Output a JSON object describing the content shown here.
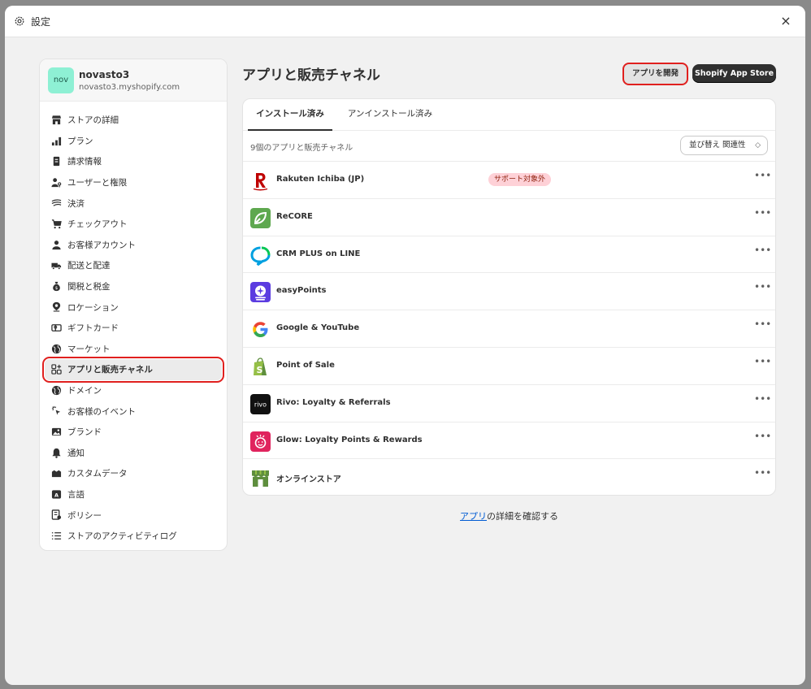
{
  "window": {
    "title": "設定",
    "close_label": "×"
  },
  "store": {
    "avatar": "nov",
    "name": "novasto3",
    "url": "novasto3.myshopify.com"
  },
  "sidebar": {
    "items": [
      {
        "label": "ストアの詳細",
        "icon": "store-icon"
      },
      {
        "label": "プラン",
        "icon": "chart-bars-icon"
      },
      {
        "label": "請求情報",
        "icon": "receipt-icon"
      },
      {
        "label": "ユーザーと権限",
        "icon": "user-key-icon"
      },
      {
        "label": "決済",
        "icon": "payment-icon"
      },
      {
        "label": "チェックアウト",
        "icon": "cart-icon"
      },
      {
        "label": "お客様アカウント",
        "icon": "person-icon"
      },
      {
        "label": "配送と配達",
        "icon": "truck-icon"
      },
      {
        "label": "関税と税金",
        "icon": "tax-bag-icon"
      },
      {
        "label": "ロケーション",
        "icon": "location-pin-icon"
      },
      {
        "label": "ギフトカード",
        "icon": "gift-card-icon"
      },
      {
        "label": "マーケット",
        "icon": "globe-icon"
      },
      {
        "label": "アプリと販売チャネル",
        "icon": "apps-icon",
        "active": true
      },
      {
        "label": "ドメイン",
        "icon": "globe-icon"
      },
      {
        "label": "お客様のイベント",
        "icon": "cursor-click-icon"
      },
      {
        "label": "ブランド",
        "icon": "brand-image-icon"
      },
      {
        "label": "通知",
        "icon": "bell-icon"
      },
      {
        "label": "カスタムデータ",
        "icon": "custom-data-icon"
      },
      {
        "label": "言語",
        "icon": "language-icon"
      },
      {
        "label": "ポリシー",
        "icon": "policy-icon"
      },
      {
        "label": "ストアのアクティビティログ",
        "icon": "list-icon"
      }
    ]
  },
  "main": {
    "title": "アプリと販売チャネル",
    "develop_button": "アプリを開発",
    "store_button": "Shopify App Store",
    "tabs": [
      {
        "label": "インストール済み",
        "selected": true
      },
      {
        "label": "アンインストール済み"
      }
    ],
    "count_text": "9個のアプリと販売チャネル",
    "sort_label": "並び替え 関連性",
    "apps": [
      {
        "name": "Rakuten Ichiba (JP)",
        "badge": "サポート対象外",
        "icon": "rakuten-icon"
      },
      {
        "name": "ReCORE",
        "icon": "recore-icon"
      },
      {
        "name": "CRM PLUS on LINE",
        "icon": "crm-plus-icon"
      },
      {
        "name": "easyPoints",
        "icon": "easypoints-icon"
      },
      {
        "name": "Google & YouTube",
        "icon": "google-icon"
      },
      {
        "name": "Point of Sale",
        "icon": "shopify-pos-icon"
      },
      {
        "name": "Rivo: Loyalty & Referrals",
        "icon": "rivo-icon"
      },
      {
        "name": "Glow: Loyalty Points & Rewards",
        "icon": "glow-icon"
      },
      {
        "name": "オンラインストア",
        "icon": "online-store-icon"
      }
    ],
    "footer_link": "アプリ",
    "footer_text": "の詳細を確認する"
  },
  "colors": {
    "accent_dark": "#303030",
    "highlight_red": "#e0201e",
    "link": "#005bd3",
    "badge_bg": "#fed1d7"
  }
}
